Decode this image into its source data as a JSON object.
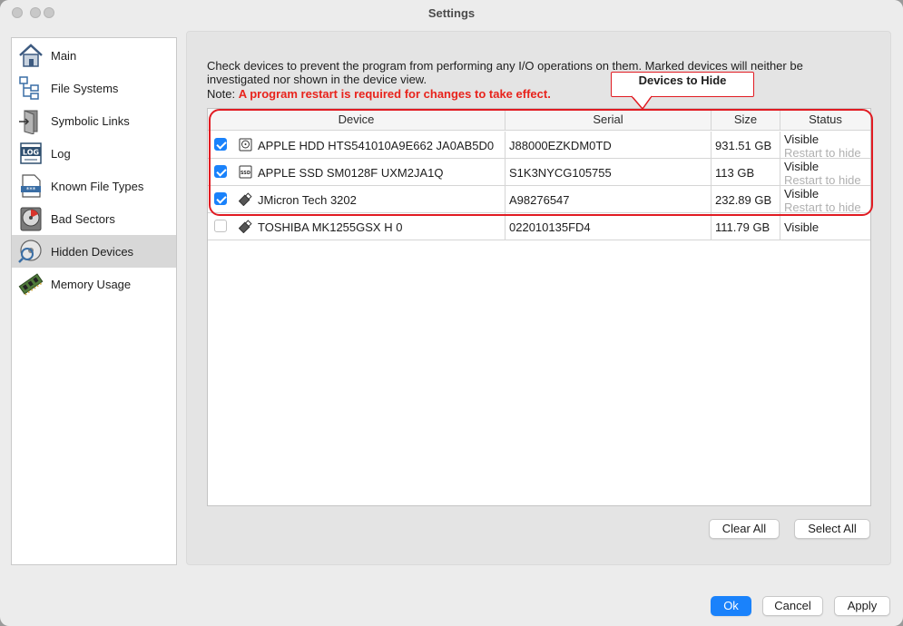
{
  "window": {
    "title": "Settings"
  },
  "sidebar": {
    "items": [
      {
        "label": "Main",
        "icon": "house-icon"
      },
      {
        "label": "File Systems",
        "icon": "tree-icon"
      },
      {
        "label": "Symbolic Links",
        "icon": "link-door-icon"
      },
      {
        "label": "Log",
        "icon": "log-icon"
      },
      {
        "label": "Known File Types",
        "icon": "file-type-icon"
      },
      {
        "label": "Bad Sectors",
        "icon": "bad-disk-icon"
      },
      {
        "label": "Hidden Devices",
        "icon": "hidden-disk-icon",
        "selected": true
      },
      {
        "label": "Memory Usage",
        "icon": "memory-chip-icon"
      }
    ]
  },
  "main": {
    "description": "Check devices to prevent the program from performing any I/O operations on them. Marked devices will neither be investigated nor shown in the device view.",
    "note_prefix": "Note: ",
    "note_warning": "A program restart is required for changes to take effect.",
    "columns": [
      "Device",
      "Serial",
      "Size",
      "Status"
    ],
    "devices": [
      {
        "checked": true,
        "icon": "hdd-icon",
        "device": "APPLE HDD HTS541010A9E662 JA0AB5D0",
        "serial": "J88000EZKDM0TD",
        "size": "931.51 GB",
        "status": "Visible",
        "status_note": "Restart to hide"
      },
      {
        "checked": true,
        "icon": "ssd-icon",
        "device": "APPLE SSD SM0128F UXM2JA1Q",
        "serial": "S1K3NYCG105755",
        "size": "113 GB",
        "status": "Visible",
        "status_note": "Restart to hide"
      },
      {
        "checked": true,
        "icon": "usb-stick-icon",
        "device": "JMicron Tech 3202",
        "serial": "A98276547",
        "size": "232.89 GB",
        "status": "Visible",
        "status_note": "Restart to hide"
      },
      {
        "checked": false,
        "icon": "usb-stick-icon",
        "device": "TOSHIBA MK1255GSX H 0",
        "serial": "022010135FD4",
        "size": "111.79 GB",
        "status": "Visible",
        "status_note": ""
      }
    ],
    "annotation": "Devices to Hide",
    "clear_all": "Clear All",
    "select_all": "Select All"
  },
  "footer": {
    "ok": "Ok",
    "cancel": "Cancel",
    "apply": "Apply"
  },
  "colors": {
    "accent": "#1a82fb",
    "warning": "#e8231c",
    "annotation": "#e11b22"
  }
}
